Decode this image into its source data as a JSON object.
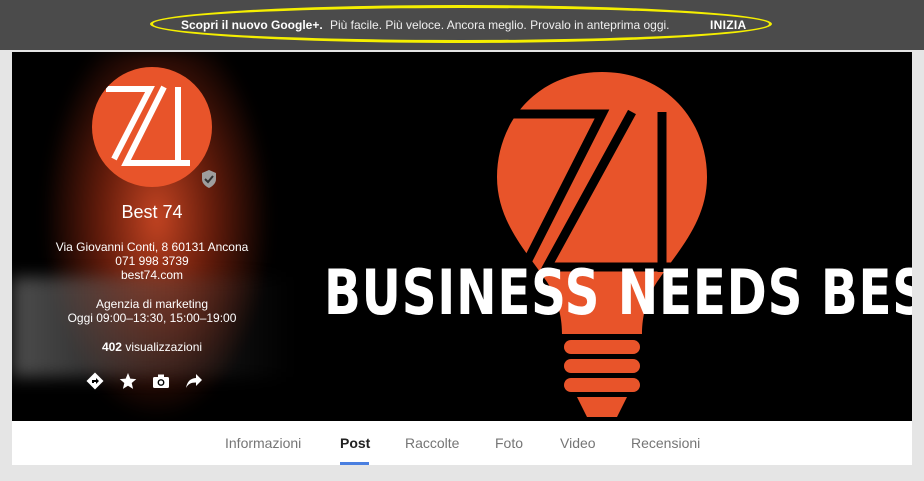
{
  "promo": {
    "bold_text": "Scopri il nuovo Google+.",
    "text": "Più facile. Più veloce. Ancora meglio. Provalo in anteprima oggi.",
    "cta": "INIZIA",
    "highlight_color": "#f5ef00"
  },
  "profile": {
    "name": "Best 74",
    "address": "Via Giovanni Conti, 8 60131 Ancona",
    "phone": "071 998 3739",
    "website": "best74.com",
    "category": "Agenzia di marketing",
    "hours": "Oggi 09:00–13:30, 15:00–19:00",
    "views_count": "402",
    "views_label": "visualizzazioni",
    "brand_color": "#e8542a",
    "logo_text": "74"
  },
  "cover": {
    "headline": "BUSINESS NEEDS BEST"
  },
  "actions": [
    {
      "icon": "directions-icon"
    },
    {
      "icon": "star-icon"
    },
    {
      "icon": "camera-icon"
    },
    {
      "icon": "share-icon"
    }
  ],
  "tabs": [
    {
      "label": "Informazioni",
      "active": false
    },
    {
      "label": "Post",
      "active": true
    },
    {
      "label": "Raccolte",
      "active": false
    },
    {
      "label": "Foto",
      "active": false
    },
    {
      "label": "Video",
      "active": false
    },
    {
      "label": "Recensioni",
      "active": false
    }
  ],
  "accent_color": "#4a7fe0"
}
